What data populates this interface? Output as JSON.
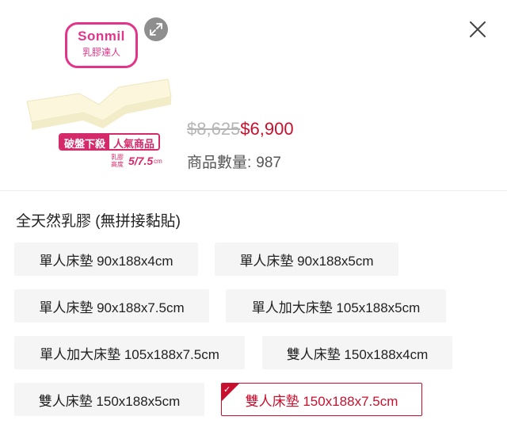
{
  "product": {
    "logo_brand": "Sonmil",
    "logo_sub": "乳膠達人",
    "promo_left": "破盤下殺",
    "promo_right": "人氣商品",
    "height_label": "乳膠高度",
    "height_value": "5/7.5",
    "height_unit": "cm",
    "original_price": "$8,625",
    "sale_price": "$6,900",
    "stock_label": "商品數量:",
    "stock_value": "987"
  },
  "icons": {
    "expand": "expand-arrows-icon",
    "close": "close-icon",
    "selected_check": "check-icon"
  },
  "colors": {
    "accent": "#c8102e",
    "brand_pink": "#e2358a",
    "option_bg": "#f5f5f5",
    "price_strike": "#b5b5b5"
  },
  "variant_group": {
    "title": "全天然乳膠 (無拼接黏貼)",
    "options": [
      {
        "label": "單人床墊 90x188x4cm",
        "selected": false
      },
      {
        "label": "單人床墊 90x188x5cm",
        "selected": false
      },
      {
        "label": "單人床墊 90x188x7.5cm",
        "selected": false
      },
      {
        "label": "單人加大床墊 105x188x5cm",
        "selected": false
      },
      {
        "label": "單人加大床墊 105x188x7.5cm",
        "selected": false
      },
      {
        "label": "雙人床墊 150x188x4cm",
        "selected": false
      },
      {
        "label": "雙人床墊 150x188x5cm",
        "selected": false
      },
      {
        "label": "雙人床墊 150x188x7.5cm",
        "selected": true
      }
    ]
  }
}
